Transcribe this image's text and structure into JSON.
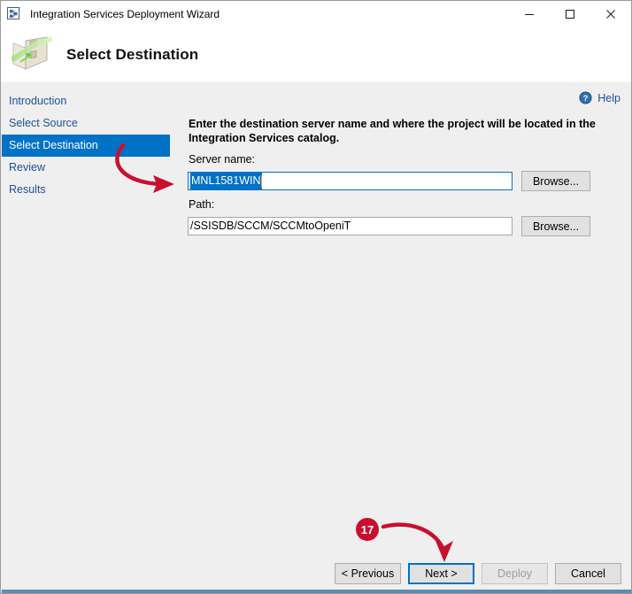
{
  "window": {
    "title": "Integration Services Deployment Wizard",
    "icon": "wizard-icon",
    "controls": {
      "minimize": "minimize-icon",
      "maximize": "maximize-icon",
      "close": "close-icon"
    }
  },
  "header": {
    "title": "Select Destination",
    "icon": "deployment-destination-icon"
  },
  "sidebar": {
    "items": [
      {
        "label": "Introduction",
        "active": false
      },
      {
        "label": "Select Source",
        "active": false
      },
      {
        "label": "Select Destination",
        "active": true
      },
      {
        "label": "Review",
        "active": false
      },
      {
        "label": "Results",
        "active": false
      }
    ]
  },
  "content": {
    "help": {
      "label": "Help",
      "icon": "help-circle-icon"
    },
    "instruction": "Enter the destination server name and where the project will be located in the Integration Services catalog.",
    "server": {
      "label": "Server name:",
      "value": "MNL1581WIN",
      "selected": true,
      "browse_label": "Browse..."
    },
    "path": {
      "label": "Path:",
      "value": "/SSISDB/SCCM/SCCMtoOpeniT",
      "browse_label": "Browse..."
    }
  },
  "footer": {
    "previous_label": "< Previous",
    "next_label": "Next >",
    "deploy_label": "Deploy",
    "cancel_label": "Cancel"
  },
  "annotations": {
    "step_badge": "17",
    "accent_color": "#c8102e",
    "arrow_to_server_field": "red-curved-arrow",
    "arrow_to_next_button": "red-curved-arrow"
  },
  "colors": {
    "selection_blue": "#0072c6",
    "link_blue": "#1f4e9c",
    "panel_gray": "#efefef",
    "annotation_red": "#c8102e"
  }
}
